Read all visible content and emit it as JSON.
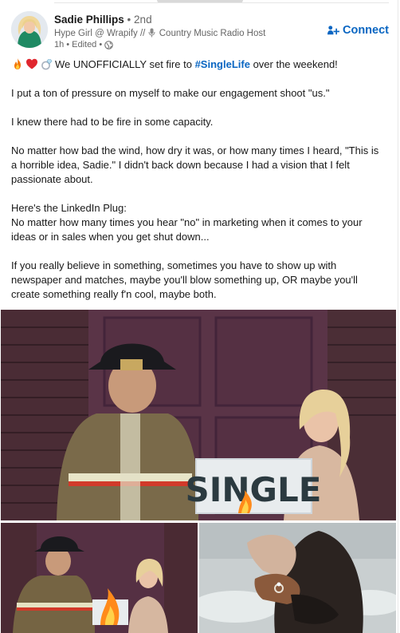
{
  "post": {
    "author": {
      "name": "Sadie Phillips",
      "separator": "•",
      "degree": "2nd",
      "headline_prefix": "Hype Girl @ Wrapify //",
      "headline_suffix": "Country Music Radio Host",
      "headline_icon": "microphone-icon",
      "time": "1h",
      "edited": "Edited",
      "visibility_icon": "globe-icon"
    },
    "connect_label": "Connect",
    "connect_icon": "add-person-icon",
    "text": {
      "emojis": [
        "fire-emoji",
        "heart-emoji",
        "ring-emoji"
      ],
      "line1_before": "We UNOFFICIALLY set fire to",
      "hashtag": "#SingleLife",
      "line1_after": "over the weekend!",
      "p2": "I put a ton of pressure on myself to make our engagement shoot \"us.\"",
      "p3": "I knew there had to be fire in some capacity.",
      "p4": "No matter how bad the wind, how dry it was, or how many times I heard, \"This is a horrible idea, Sadie.\" I didn't back down because I had a vision that I felt passionate about.",
      "p5_heading": "Here's the LinkedIn Plug:",
      "p5_body": "No matter how many times you hear \"no\" in marketing when it comes to your ideas or in sales when you get shut down...",
      "p6": "If you really believe in something, sometimes you have to show up with newspaper and matches, maybe you'll blow something up, OR maybe you'll create something really f'n cool, maybe both."
    },
    "images": {
      "main_sign_text": "SINGLE"
    },
    "colors": {
      "link_blue": "#0a66c2",
      "muted_gray": "#666666",
      "text": "#191919"
    }
  }
}
